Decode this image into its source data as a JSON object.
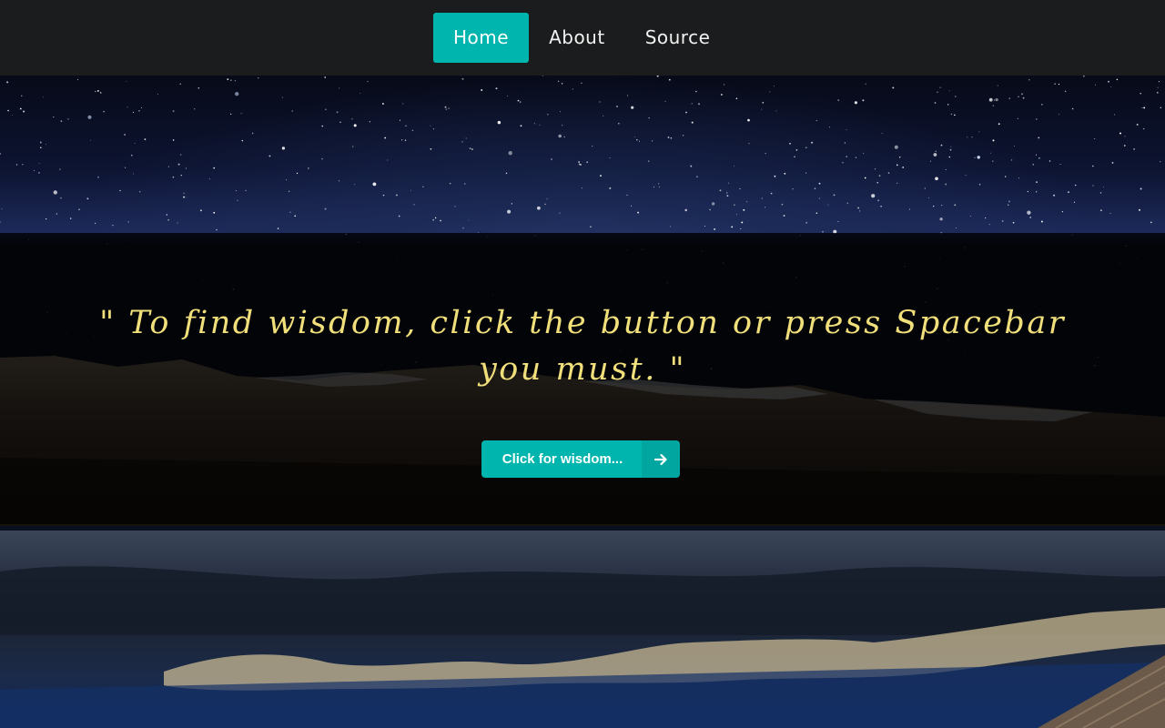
{
  "nav": {
    "items": [
      {
        "label": "Home",
        "active": true
      },
      {
        "label": "About",
        "active": false
      },
      {
        "label": "Source",
        "active": false
      }
    ]
  },
  "hero": {
    "quote": "\" To find wisdom, click the button or press Spacebar you must. \"",
    "button_label": "Click for wisdom...",
    "button_icon": "arrow-right-icon"
  },
  "colors": {
    "accent": "#00b5ad",
    "nav_background": "#1b1c1d",
    "quote_text": "#f0df7a"
  }
}
